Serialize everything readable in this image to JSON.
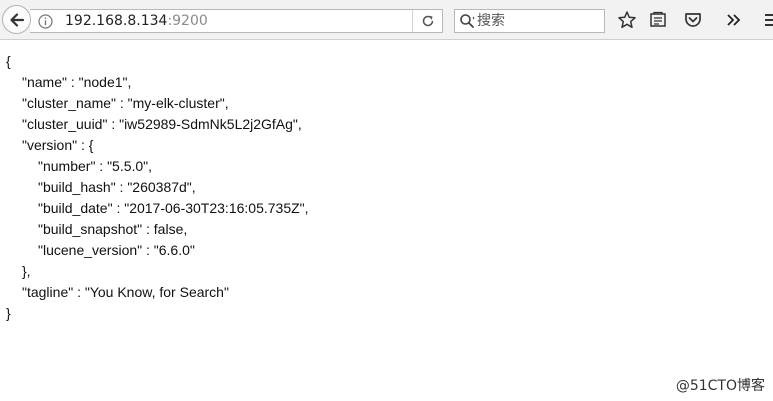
{
  "browser": {
    "url_host": "192.168.8.134",
    "url_port": ":9200",
    "search_placeholder": "搜索"
  },
  "json_lines": [
    "{",
    "\"name\" : \"node1\",",
    "\"cluster_name\" : \"my-elk-cluster\",",
    "\"cluster_uuid\" : \"iw52989-SdmNk5L2j2GfAg\",",
    "\"version\" : {",
    "\"number\" : \"5.5.0\",",
    "\"build_hash\" : \"260387d\",",
    "\"build_date\" : \"2017-06-30T23:16:05.735Z\",",
    "\"build_snapshot\" : false,",
    "\"lucene_version\" : \"6.6.0\"",
    "},",
    "\"tagline\" : \"You Know, for Search\"",
    "}"
  ],
  "watermark": "@51CTO博客",
  "icons": {
    "back": "back-arrow-icon",
    "info": "info-icon",
    "reload": "reload-icon",
    "search": "search-icon",
    "bookmark": "star-icon",
    "library": "reading-list-icon",
    "pocket": "pocket-icon",
    "overflow": "overflow-chevron-icon",
    "menu": "hamburger-menu-icon"
  }
}
